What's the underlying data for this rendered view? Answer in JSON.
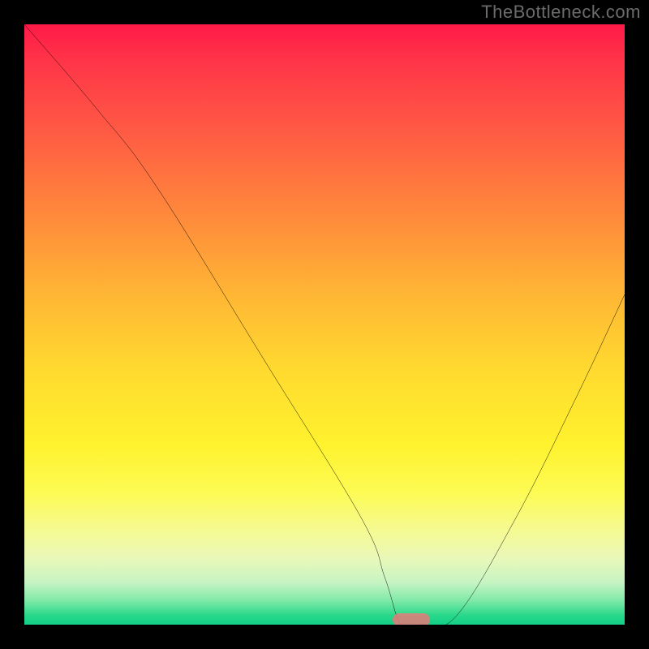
{
  "watermark": "TheBottleneck.com",
  "colors": {
    "black": "#000000",
    "curve": "#000000",
    "pill": "#e77a7a"
  },
  "chart_data": {
    "type": "line",
    "title": "",
    "xlabel": "",
    "ylabel": "",
    "xlim": [
      0,
      100
    ],
    "ylim": [
      0,
      100
    ],
    "grid": false,
    "series": [
      {
        "name": "bottleneck-curve",
        "x": [
          0,
          12,
          22,
          40,
          56,
          60,
          62,
          63,
          66,
          72,
          82,
          92,
          100
        ],
        "values": [
          100,
          86,
          73,
          44,
          18,
          8,
          1.5,
          0,
          0,
          1.5,
          18,
          38,
          55
        ]
      }
    ],
    "markers": [
      {
        "name": "optimal-range",
        "x": 64.5,
        "y": 0,
        "shape": "pill",
        "color": "#e77a7a"
      }
    ],
    "background_gradient_stops": [
      {
        "pct": 0,
        "color": "#ff1a47"
      },
      {
        "pct": 18,
        "color": "#ff5b44"
      },
      {
        "pct": 46,
        "color": "#ffb934"
      },
      {
        "pct": 70,
        "color": "#fff22e"
      },
      {
        "pct": 89,
        "color": "#e9f8b9"
      },
      {
        "pct": 100,
        "color": "#12cf87"
      }
    ]
  }
}
